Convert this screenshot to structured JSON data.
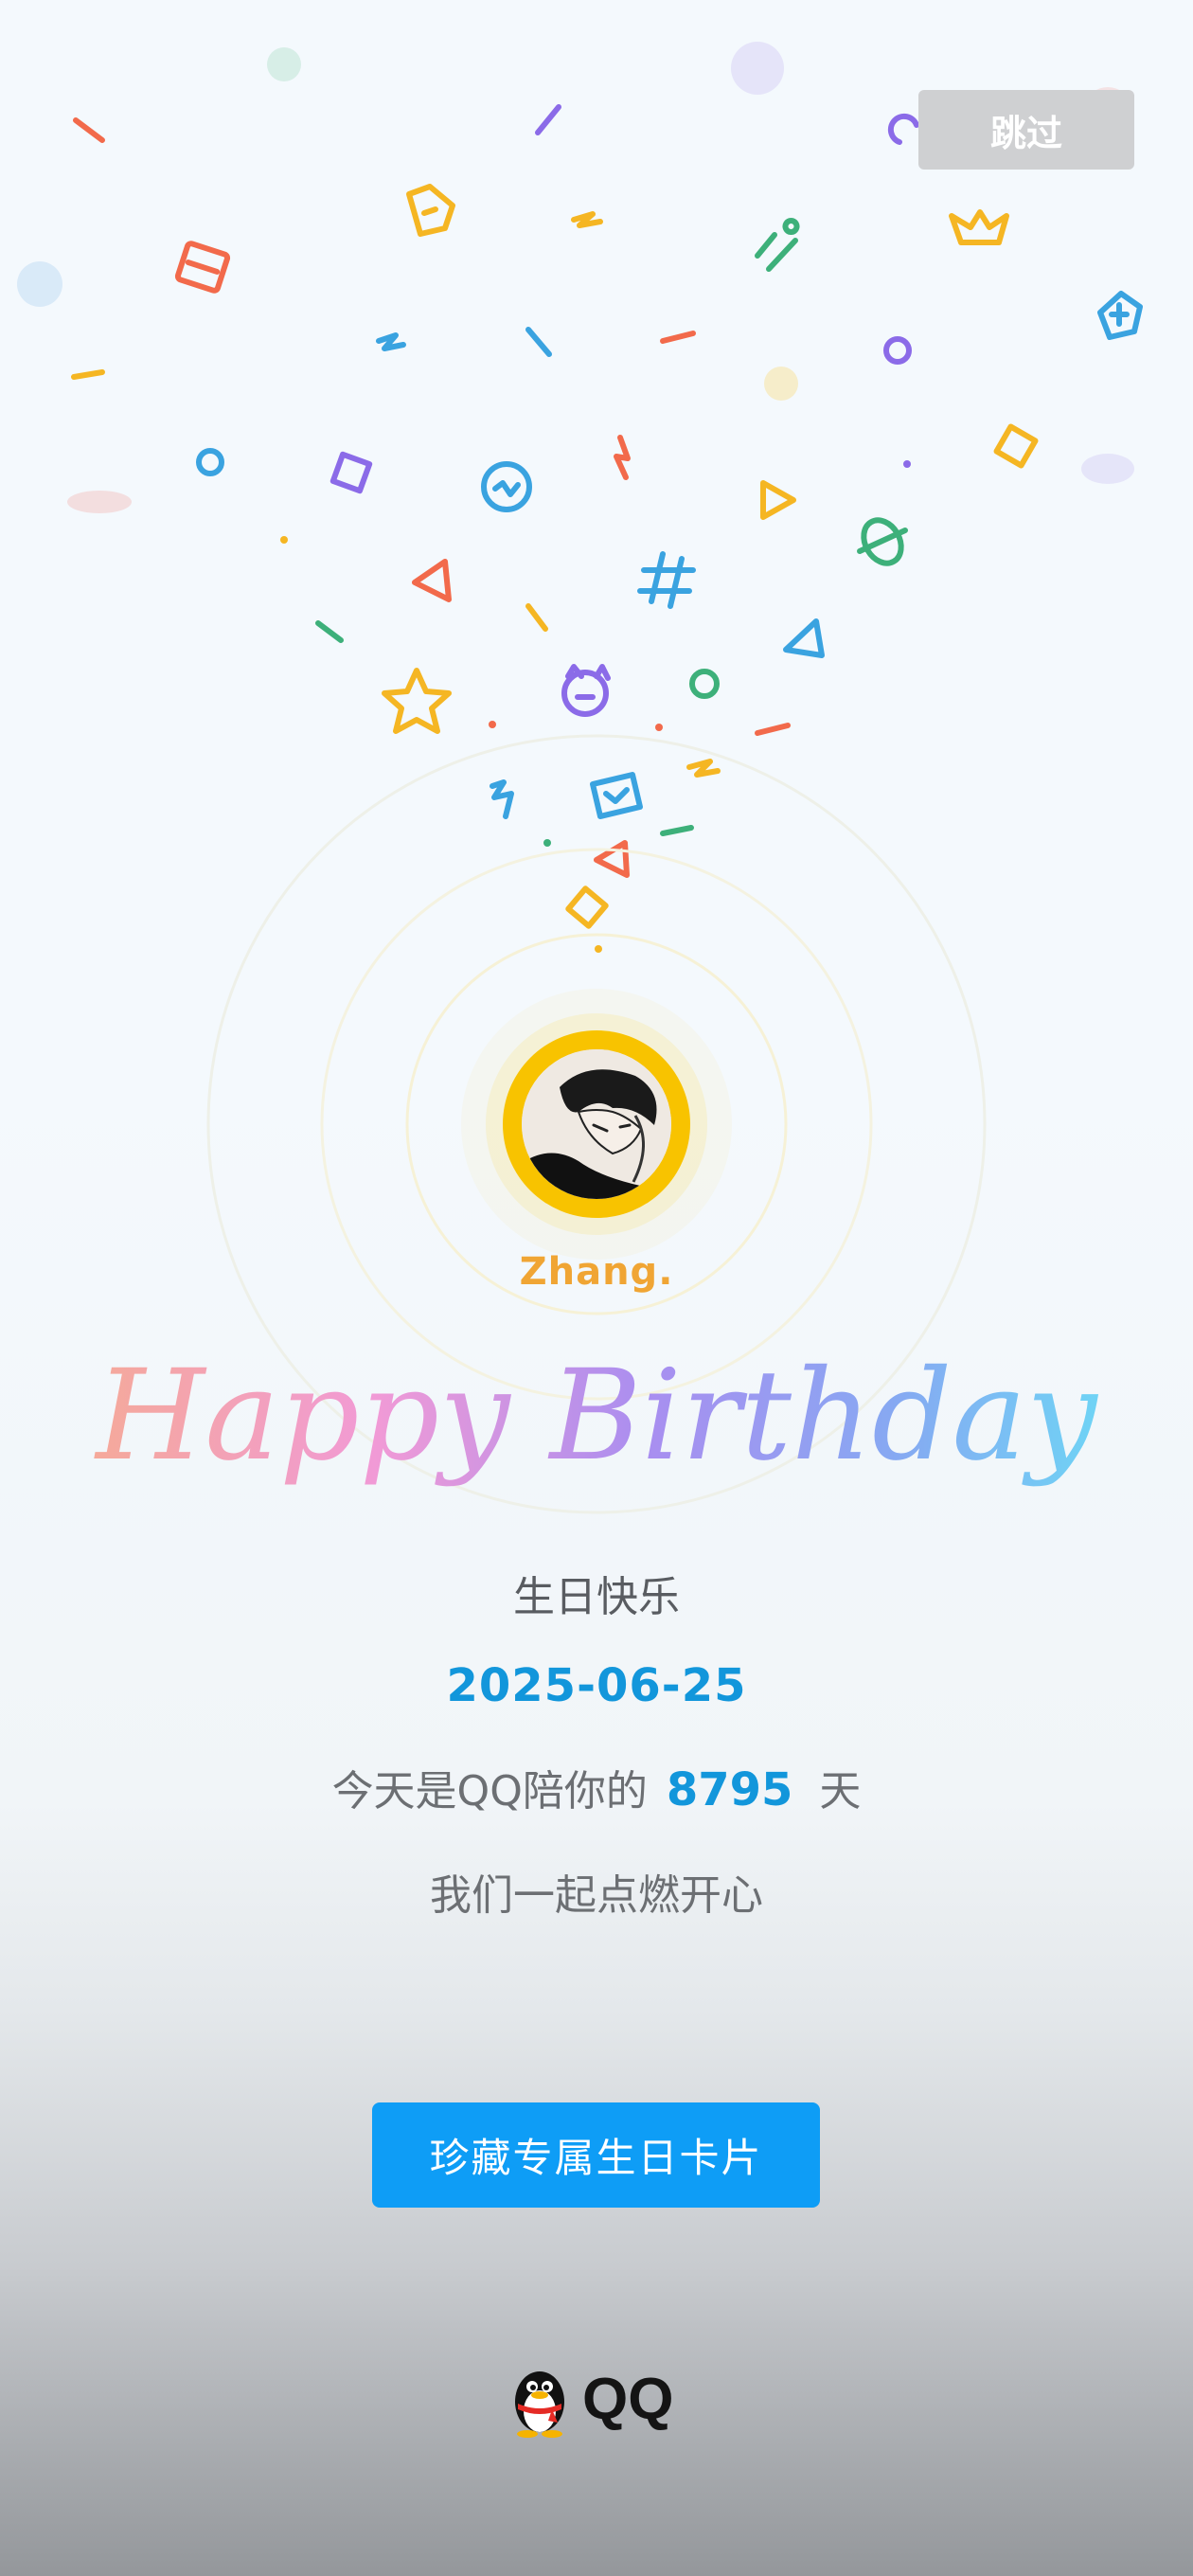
{
  "header": {
    "skip_label": "跳过"
  },
  "profile": {
    "nickname": "Zhang."
  },
  "title": {
    "script_text": "Happy Birthday"
  },
  "message": {
    "greeting": "生日快乐",
    "date": "2025-06-25",
    "days_prefix": "今天是QQ陪你的",
    "days_count": "8795",
    "days_suffix": "天",
    "together": "我们一起点燃开心"
  },
  "actions": {
    "save_card_label": "珍藏专属生日卡片"
  },
  "brand": {
    "name": "QQ"
  },
  "colors": {
    "accent_blue": "#1296db",
    "button_blue": "#0e9df6",
    "avatar_ring": "#f8c300",
    "nickname": "#f0a534"
  }
}
